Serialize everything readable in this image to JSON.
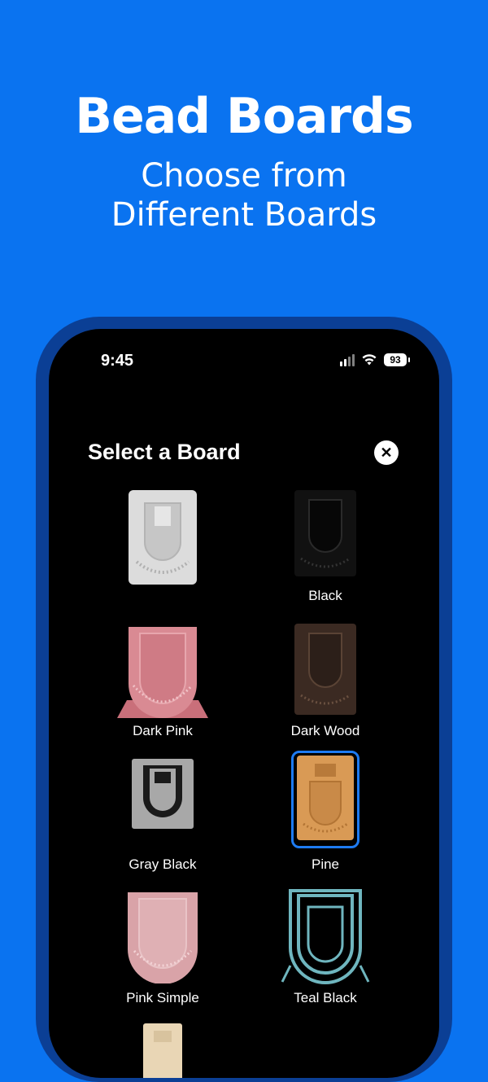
{
  "hero": {
    "title": "Bead Boards",
    "subtitle_line1": "Choose from",
    "subtitle_line2": "Different Boards"
  },
  "status_bar": {
    "time": "9:45",
    "battery": "93",
    "icons": [
      "signal-icon",
      "wifi-icon",
      "battery-icon"
    ]
  },
  "sheet": {
    "title": "Select a Board",
    "close_icon": "close-icon"
  },
  "boards": [
    {
      "label": "",
      "color": "#dcdcdc",
      "selected": false
    },
    {
      "label": "Black",
      "color": "#111111",
      "selected": false
    },
    {
      "label": "Dark Pink",
      "color": "#d98a93",
      "selected": false
    },
    {
      "label": "Dark Wood",
      "color": "#3b2a22",
      "selected": false
    },
    {
      "label": "Gray Black",
      "color": "#a8a8a8",
      "selected": false
    },
    {
      "label": "Pine",
      "color": "#d99a55",
      "selected": true
    },
    {
      "label": "Pink Simple",
      "color": "#d9a3a8",
      "selected": false
    },
    {
      "label": "Teal Black",
      "color": "#6fb6bf",
      "selected": false
    },
    {
      "label": "",
      "color": "#e9d6b5",
      "selected": false
    }
  ],
  "colors": {
    "background": "#0a73f0",
    "phone_frame": "#0b3f95",
    "selection": "#1e7bf2"
  }
}
